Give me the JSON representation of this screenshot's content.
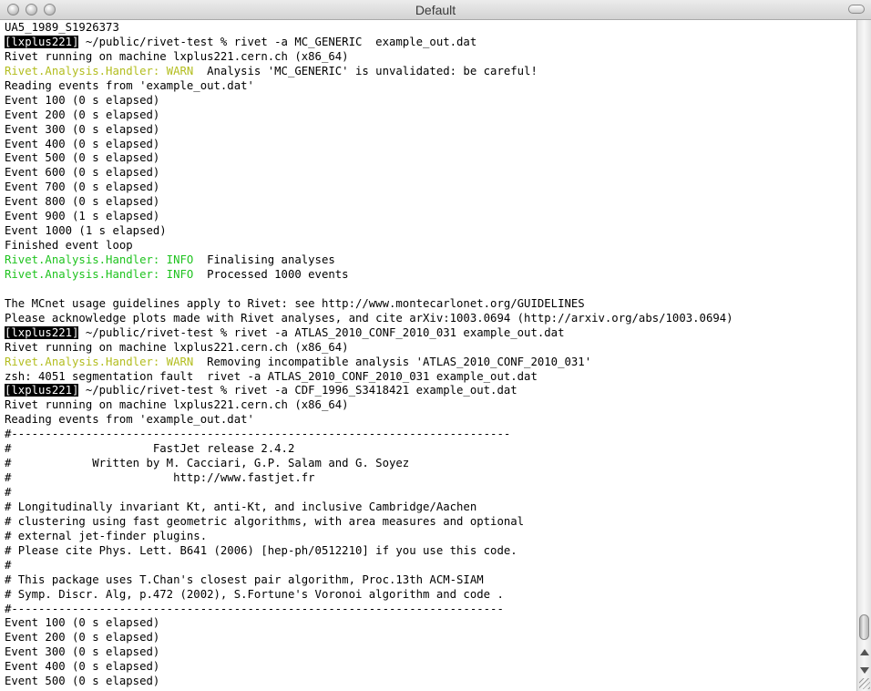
{
  "window": {
    "title": "Default"
  },
  "colors": {
    "warn": "#b3bd1f",
    "info": "#1fc31f",
    "host_bg": "#000000"
  },
  "icons": {
    "close": "close-button-icon",
    "minimize": "minimize-button-icon",
    "zoom": "zoom-button-icon",
    "toolbar": "toolbar-toggle-icon"
  },
  "terminal": {
    "lines": [
      {
        "segments": [
          {
            "style": "plain",
            "text": "UA5_1989_S1926373"
          }
        ]
      },
      {
        "segments": [
          {
            "style": "host",
            "text": "[lxplus221]"
          },
          {
            "style": "plain",
            "text": " ~/public/rivet-test % rivet -a MC_GENERIC  example_out.dat"
          }
        ]
      },
      {
        "segments": [
          {
            "style": "plain",
            "text": "Rivet running on machine lxplus221.cern.ch (x86_64)"
          }
        ]
      },
      {
        "segments": [
          {
            "style": "warn",
            "text": "Rivet.Analysis.Handler: WARN"
          },
          {
            "style": "plain",
            "text": "  Analysis 'MC_GENERIC' is unvalidated: be careful!"
          }
        ]
      },
      {
        "segments": [
          {
            "style": "plain",
            "text": "Reading events from 'example_out.dat'"
          }
        ]
      },
      {
        "segments": [
          {
            "style": "plain",
            "text": "Event 100 (0 s elapsed)"
          }
        ]
      },
      {
        "segments": [
          {
            "style": "plain",
            "text": "Event 200 (0 s elapsed)"
          }
        ]
      },
      {
        "segments": [
          {
            "style": "plain",
            "text": "Event 300 (0 s elapsed)"
          }
        ]
      },
      {
        "segments": [
          {
            "style": "plain",
            "text": "Event 400 (0 s elapsed)"
          }
        ]
      },
      {
        "segments": [
          {
            "style": "plain",
            "text": "Event 500 (0 s elapsed)"
          }
        ]
      },
      {
        "segments": [
          {
            "style": "plain",
            "text": "Event 600 (0 s elapsed)"
          }
        ]
      },
      {
        "segments": [
          {
            "style": "plain",
            "text": "Event 700 (0 s elapsed)"
          }
        ]
      },
      {
        "segments": [
          {
            "style": "plain",
            "text": "Event 800 (0 s elapsed)"
          }
        ]
      },
      {
        "segments": [
          {
            "style": "plain",
            "text": "Event 900 (1 s elapsed)"
          }
        ]
      },
      {
        "segments": [
          {
            "style": "plain",
            "text": "Event 1000 (1 s elapsed)"
          }
        ]
      },
      {
        "segments": [
          {
            "style": "plain",
            "text": "Finished event loop"
          }
        ]
      },
      {
        "segments": [
          {
            "style": "info",
            "text": "Rivet.Analysis.Handler: INFO"
          },
          {
            "style": "plain",
            "text": "  Finalising analyses"
          }
        ]
      },
      {
        "segments": [
          {
            "style": "info",
            "text": "Rivet.Analysis.Handler: INFO"
          },
          {
            "style": "plain",
            "text": "  Processed 1000 events"
          }
        ]
      },
      {
        "segments": [
          {
            "style": "plain",
            "text": ""
          }
        ]
      },
      {
        "segments": [
          {
            "style": "plain",
            "text": "The MCnet usage guidelines apply to Rivet: see http://www.montecarlonet.org/GUIDELINES"
          }
        ]
      },
      {
        "segments": [
          {
            "style": "plain",
            "text": "Please acknowledge plots made with Rivet analyses, and cite arXiv:1003.0694 (http://arxiv.org/abs/1003.0694)"
          }
        ]
      },
      {
        "segments": [
          {
            "style": "host",
            "text": "[lxplus221]"
          },
          {
            "style": "plain",
            "text": " ~/public/rivet-test % rivet -a ATLAS_2010_CONF_2010_031 example_out.dat"
          }
        ]
      },
      {
        "segments": [
          {
            "style": "plain",
            "text": "Rivet running on machine lxplus221.cern.ch (x86_64)"
          }
        ]
      },
      {
        "segments": [
          {
            "style": "warn",
            "text": "Rivet.Analysis.Handler: WARN"
          },
          {
            "style": "plain",
            "text": "  Removing incompatible analysis 'ATLAS_2010_CONF_2010_031'"
          }
        ]
      },
      {
        "segments": [
          {
            "style": "plain",
            "text": "zsh: 4051 segmentation fault  rivet -a ATLAS_2010_CONF_2010_031 example_out.dat"
          }
        ]
      },
      {
        "segments": [
          {
            "style": "host",
            "text": "[lxplus221]"
          },
          {
            "style": "plain",
            "text": " ~/public/rivet-test % rivet -a CDF_1996_S3418421 example_out.dat"
          }
        ]
      },
      {
        "segments": [
          {
            "style": "plain",
            "text": "Rivet running on machine lxplus221.cern.ch (x86_64)"
          }
        ]
      },
      {
        "segments": [
          {
            "style": "plain",
            "text": "Reading events from 'example_out.dat'"
          }
        ]
      },
      {
        "segments": [
          {
            "style": "plain",
            "text": "#--------------------------------------------------------------------------"
          }
        ]
      },
      {
        "segments": [
          {
            "style": "plain",
            "text": "#                     FastJet release 2.4.2"
          }
        ]
      },
      {
        "segments": [
          {
            "style": "plain",
            "text": "#            Written by M. Cacciari, G.P. Salam and G. Soyez"
          }
        ]
      },
      {
        "segments": [
          {
            "style": "plain",
            "text": "#                        http://www.fastjet.fr"
          }
        ]
      },
      {
        "segments": [
          {
            "style": "plain",
            "text": "#"
          }
        ]
      },
      {
        "segments": [
          {
            "style": "plain",
            "text": "# Longitudinally invariant Kt, anti-Kt, and inclusive Cambridge/Aachen"
          }
        ]
      },
      {
        "segments": [
          {
            "style": "plain",
            "text": "# clustering using fast geometric algorithms, with area measures and optional"
          }
        ]
      },
      {
        "segments": [
          {
            "style": "plain",
            "text": "# external jet-finder plugins."
          }
        ]
      },
      {
        "segments": [
          {
            "style": "plain",
            "text": "# Please cite Phys. Lett. B641 (2006) [hep-ph/0512210] if you use this code."
          }
        ]
      },
      {
        "segments": [
          {
            "style": "plain",
            "text": "#"
          }
        ]
      },
      {
        "segments": [
          {
            "style": "plain",
            "text": "# This package uses T.Chan's closest pair algorithm, Proc.13th ACM-SIAM"
          }
        ]
      },
      {
        "segments": [
          {
            "style": "plain",
            "text": "# Symp. Discr. Alg, p.472 (2002), S.Fortune's Voronoi algorithm and code ."
          }
        ]
      },
      {
        "segments": [
          {
            "style": "plain",
            "text": "#-------------------------------------------------------------------------"
          }
        ]
      },
      {
        "segments": [
          {
            "style": "plain",
            "text": "Event 100 (0 s elapsed)"
          }
        ]
      },
      {
        "segments": [
          {
            "style": "plain",
            "text": "Event 200 (0 s elapsed)"
          }
        ]
      },
      {
        "segments": [
          {
            "style": "plain",
            "text": "Event 300 (0 s elapsed)"
          }
        ]
      },
      {
        "segments": [
          {
            "style": "plain",
            "text": "Event 400 (0 s elapsed)"
          }
        ]
      },
      {
        "segments": [
          {
            "style": "plain",
            "text": "Event 500 (0 s elapsed)"
          }
        ]
      }
    ]
  }
}
